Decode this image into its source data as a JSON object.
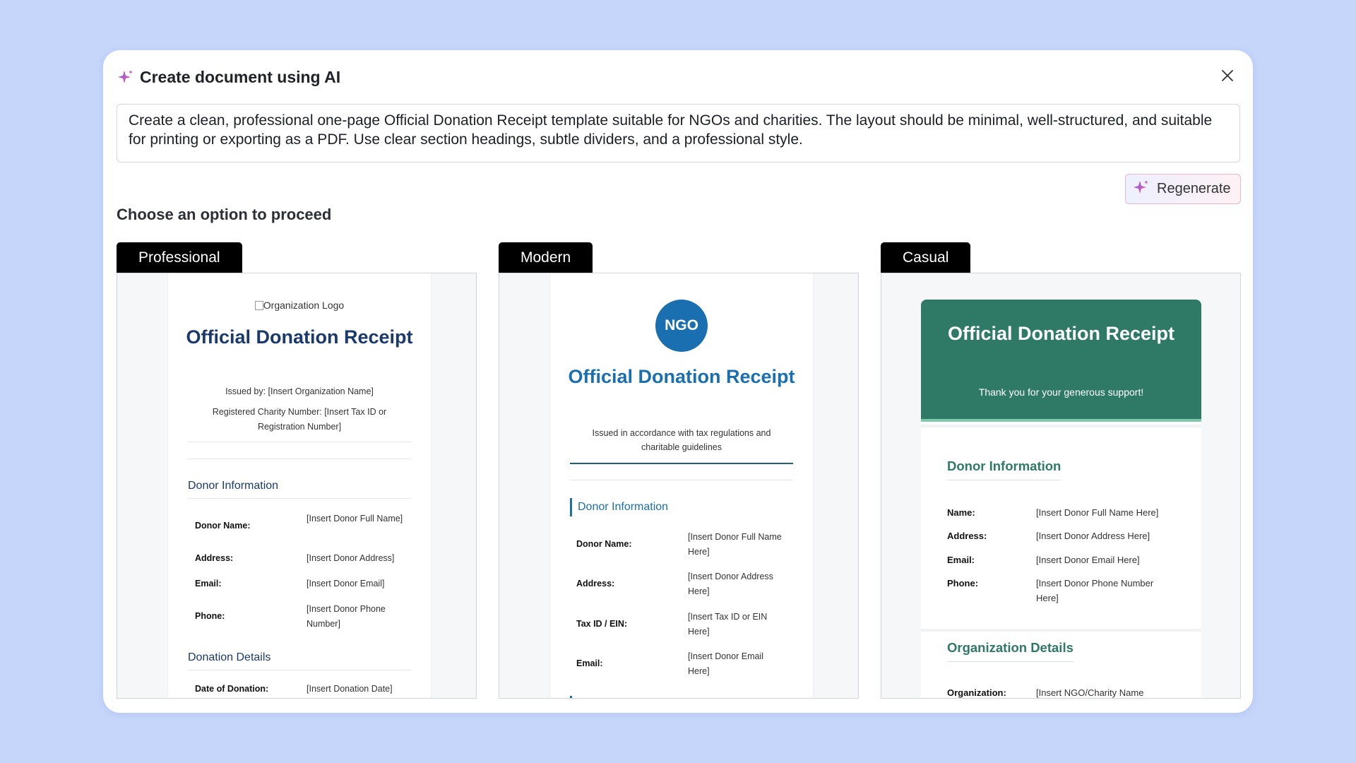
{
  "dialog": {
    "title": "Create document using AI",
    "prompt": "Create a clean, professional one-page Official Donation Receipt template suitable for NGOs and charities. The layout should be minimal, well-structured, and suitable for printing or exporting as a PDF. Use clear section headings, subtle dividers, and a professional style.",
    "regenerate_label": "Regenerate",
    "choose_heading": "Choose an option to proceed",
    "icons": {
      "sparkle": "sparkle-icon",
      "close": "close-icon"
    }
  },
  "options": {
    "professional": {
      "tab_label": "Professional",
      "logo_alt": "Organization Logo",
      "title": "Official Donation Receipt",
      "issued_by": "Issued by: [Insert Organization Name]",
      "charity_number": "Registered Charity Number: [Insert Tax ID or Registration Number]",
      "donor_section": "Donor Information",
      "donor_rows": [
        {
          "label": "Donor Name:",
          "value": "[Insert Donor Full Name]"
        },
        {
          "label": "Address:",
          "value": "[Insert Donor Address]"
        },
        {
          "label": "Email:",
          "value": "[Insert Donor Email]"
        },
        {
          "label": "Phone:",
          "value": "[Insert Donor Phone Number]"
        }
      ],
      "donation_section": "Donation Details",
      "donation_rows": [
        {
          "label": "Date of Donation:",
          "value": "[Insert Donation Date]"
        }
      ]
    },
    "modern": {
      "tab_label": "Modern",
      "badge": "NGO",
      "title": "Official Donation Receipt",
      "subtitle": "Issued in accordance with tax regulations and charitable guidelines",
      "donor_section": "Donor Information",
      "donor_rows": [
        {
          "label": "Donor Name:",
          "value": "[Insert Donor Full Name Here]"
        },
        {
          "label": "Address:",
          "value": "[Insert Donor Address Here]"
        },
        {
          "label": "Tax ID / EIN:",
          "value": "[Insert Tax ID or EIN Here]"
        },
        {
          "label": "Email:",
          "value": "[Insert Donor Email Here]"
        }
      ]
    },
    "casual": {
      "tab_label": "Casual",
      "title": "Official Donation Receipt",
      "subtitle": "Thank you for your generous support!",
      "donor_section": "Donor Information",
      "donor_rows": [
        {
          "label": "Name:",
          "value": "[Insert Donor Full Name Here]"
        },
        {
          "label": "Address:",
          "value": "[Insert Donor Address Here]"
        },
        {
          "label": "Email:",
          "value": "[Insert Donor Email Here]"
        },
        {
          "label": "Phone:",
          "value": "[Insert Donor Phone Number Here]"
        }
      ],
      "org_section": "Organization Details",
      "org_rows": [
        {
          "label": "Organization:",
          "value": "[Insert NGO/Charity Name"
        }
      ]
    }
  }
}
